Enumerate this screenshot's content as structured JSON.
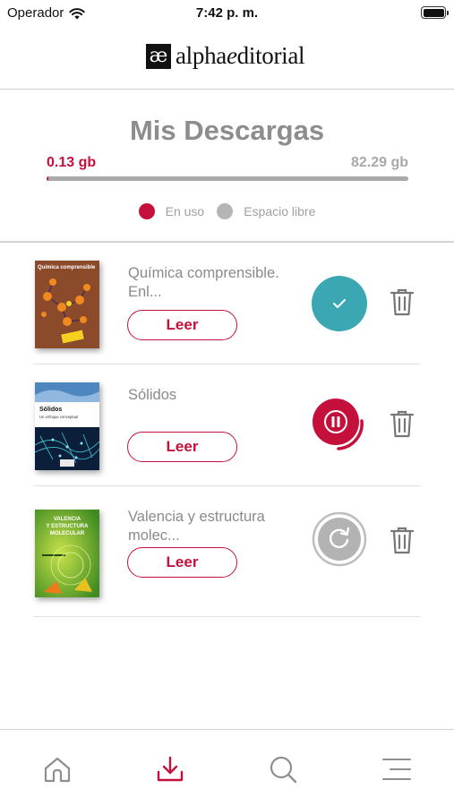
{
  "status_bar": {
    "carrier": "Operador",
    "time": "7:42 p. m."
  },
  "header": {
    "logo_mark": "æ",
    "logo_text_prefix": "alpha",
    "logo_text_italic": "e",
    "logo_text_suffix": "ditorial"
  },
  "downloads": {
    "title": "Mis Descargas",
    "used": "0.13 gb",
    "free": "82.29 gb",
    "used_fraction": 0.0016,
    "legend_used": "En uso",
    "legend_free": "Espacio libre",
    "used_color": "#c4103a",
    "free_color": "#b5b5b5"
  },
  "books": [
    {
      "title": "Química comprensible. Enl...",
      "cover_title": "Química comprensible",
      "read_label": "Leer",
      "status": "downloaded",
      "status_icon": "check-icon"
    },
    {
      "title": "Sólidos",
      "cover_title": "Sólidos",
      "cover_subtitle": "Un enfoque conceptual",
      "read_label": "Leer",
      "status": "downloading",
      "status_icon": "pause-icon"
    },
    {
      "title": "Valencia y estructura molec...",
      "cover_title": "VALENCIA Y ESTRUCTURA MOLECULAR",
      "read_label": "Leer",
      "status": "pending",
      "status_icon": "retry-icon"
    }
  ],
  "tabbar": {
    "items": [
      {
        "name": "home",
        "icon": "home-icon",
        "active": false
      },
      {
        "name": "downloads",
        "icon": "download-icon",
        "active": true
      },
      {
        "name": "search",
        "icon": "search-icon",
        "active": false
      },
      {
        "name": "menu",
        "icon": "menu-icon",
        "active": false
      }
    ],
    "active_color": "#c4103a",
    "inactive_color": "#8e8e8e"
  }
}
